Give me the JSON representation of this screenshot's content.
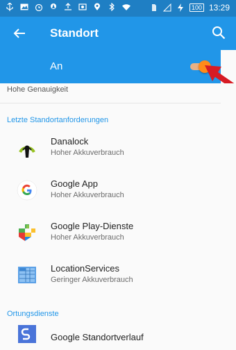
{
  "statusbar": {
    "time": "13:29",
    "battery": "100",
    "left_icons": [
      "usb-icon",
      "image-icon",
      "clock-icon",
      "location-icon",
      "upload-icon",
      "photo-icon",
      "location-pin-icon",
      "bluetooth-icon",
      "wifi-icon"
    ],
    "right_icons": [
      "sim-icon",
      "signal-icon",
      "charging-icon"
    ]
  },
  "appbar": {
    "title": "Standort",
    "back_icon": "back-arrow-icon",
    "search_icon": "search-icon"
  },
  "toggle": {
    "label": "An",
    "subtitle": "Hohe Genauigkeit",
    "state": "on",
    "colors": {
      "thumb": "#ff8a1a",
      "track": "#ffb47a"
    }
  },
  "sections": {
    "recent_title": "Letzte Standortanforderungen",
    "services_title": "Ortungsdienste"
  },
  "recent": [
    {
      "name": "Danalock",
      "detail": "Hoher Akkuverbrauch",
      "icon": "danalock-icon"
    },
    {
      "name": "Google App",
      "detail": "Hoher Akkuverbrauch",
      "icon": "google-icon"
    },
    {
      "name": "Google Play-Dienste",
      "detail": "Hoher Akkuverbrauch",
      "icon": "google-play-services-icon"
    },
    {
      "name": "LocationServices",
      "detail": "Geringer Akkuverbrauch",
      "icon": "location-services-icon"
    }
  ],
  "services": [
    {
      "name": "Google Standortverlauf",
      "icon": "google-location-history-icon"
    }
  ],
  "colors": {
    "appbar": "#2196e8",
    "statusbar": "#1f7fc4",
    "accent": "#2196e8",
    "annotation_arrow": "#d71b24"
  }
}
